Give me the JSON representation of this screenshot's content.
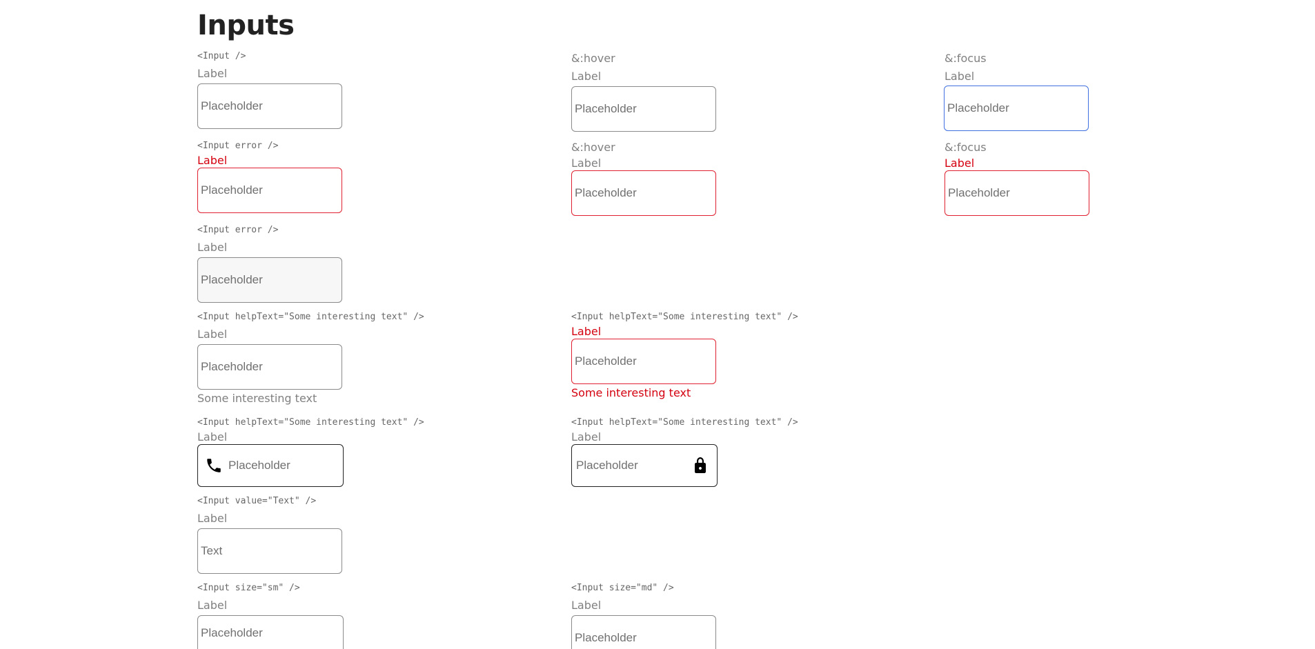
{
  "page": {
    "title": "Inputs"
  },
  "rows": {
    "default": {
      "code": "<Input />",
      "hover_state": "&:hover",
      "focus_state": "&:focus",
      "label": "Label",
      "placeholder": "Placeholder"
    },
    "error": {
      "code": "<Input error />",
      "hover_state": "&:hover",
      "focus_state": "&:focus",
      "label": "Label",
      "placeholder": "Placeholder"
    },
    "disabled": {
      "code": "<Input error />",
      "label": "Label",
      "placeholder": "Placeholder"
    },
    "help": {
      "code": "<Input helpText=\"Some interesting text\" />",
      "label": "Label",
      "placeholder": "Placeholder",
      "help_text": "Some interesting text",
      "error_code": "<Input helpText=\"Some interesting text\" />",
      "error_label": "Label",
      "error_placeholder": "Placeholder",
      "error_help_text": "Some interesting text"
    },
    "icons": {
      "phone_code": "<Input helpText=\"Some interesting text\" />",
      "phone_label": "Label",
      "phone_placeholder": "Placeholder",
      "phone_icon": "phone-icon",
      "lock_code": "<Input helpText=\"Some interesting text\" />",
      "lock_label": "Label",
      "lock_placeholder": "Placeholder",
      "lock_icon": "lock-icon"
    },
    "value": {
      "code": "<Input value=\"Text\" />",
      "label": "Label",
      "value": "Text"
    },
    "sizes": {
      "sm_code": "<Input size=\"sm\" />",
      "sm_label": "Label",
      "sm_placeholder": "Placeholder",
      "md_code": "<Input size=\"md\" />",
      "md_label": "Label",
      "md_placeholder": "Placeholder"
    }
  },
  "colors": {
    "error": "#d4000f",
    "focus": "#3f6fe0",
    "border": "#8a8a8a"
  }
}
